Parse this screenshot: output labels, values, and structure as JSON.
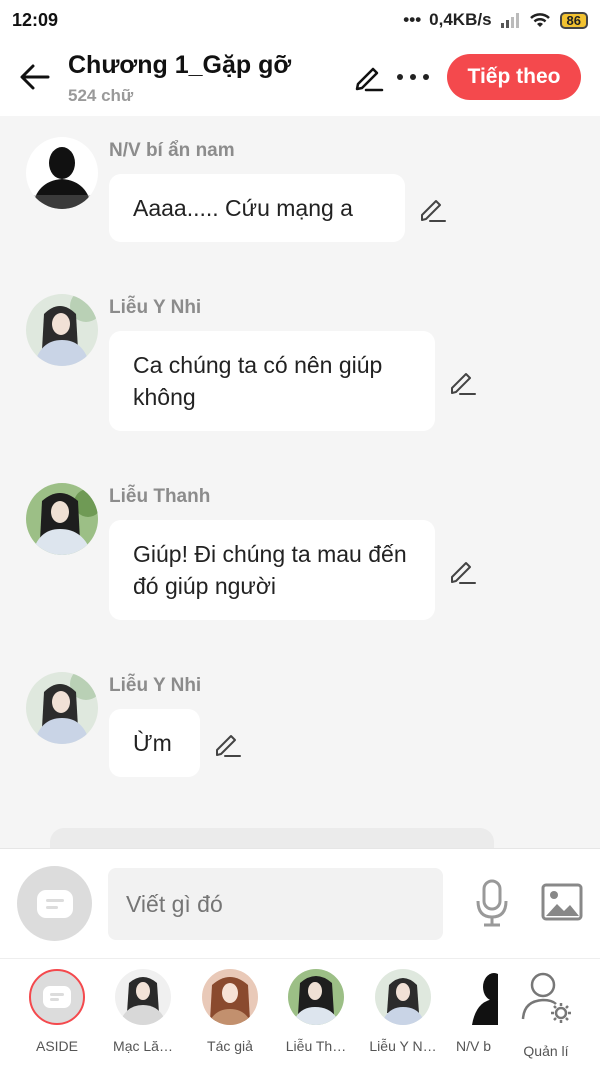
{
  "status_bar": {
    "time": "12:09",
    "network_speed": "0,4KB/s",
    "battery": "86"
  },
  "header": {
    "title": "Chương 1_Gặp gỡ",
    "word_count": "524 chữ",
    "next_label": "Tiếp theo"
  },
  "messages": [
    {
      "sender": "N/V bí ẩn nam",
      "text": "Aaaa..... Cứu mạng a"
    },
    {
      "sender": "Liễu Y Nhi",
      "text": "Ca chúng ta có nên giúp không"
    },
    {
      "sender": "Liễu Thanh",
      "text": "Giúp! Đi chúng ta mau đến đó giúp người"
    },
    {
      "sender": "Liễu Y Nhi",
      "text": "Ừm"
    }
  ],
  "composer": {
    "placeholder": "Viết gì đó"
  },
  "characters": [
    {
      "label": "ASIDE"
    },
    {
      "label": "Mạc Lă…"
    },
    {
      "label": "Tác giả"
    },
    {
      "label": "Liễu Th…"
    },
    {
      "label": "Liễu Y N…"
    },
    {
      "label": "N/V b"
    },
    {
      "label": "Quản lí"
    }
  ],
  "colors": {
    "accent": "#f4494d",
    "background": "#f5f5f5",
    "bubble": "#ffffff",
    "sender_text": "#8c8c8c"
  },
  "icons": {
    "back": "arrow-left-icon",
    "edit": "pencil-icon",
    "more": "more-dots-icon",
    "mic": "microphone-icon",
    "image": "image-icon",
    "manage": "user-gear-icon"
  }
}
